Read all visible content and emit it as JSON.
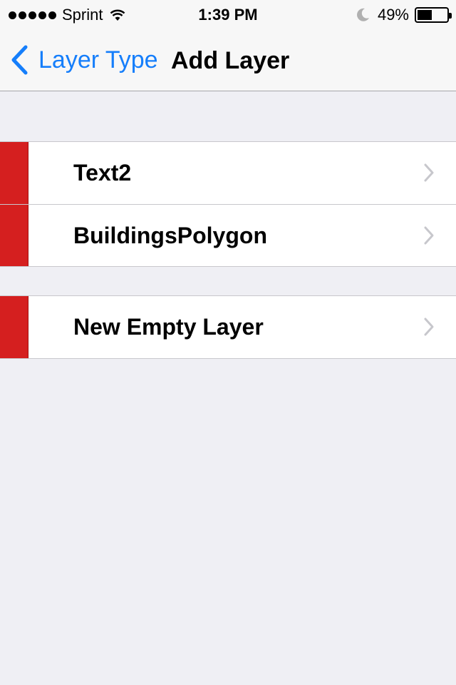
{
  "status_bar": {
    "carrier": "Sprint",
    "time": "1:39 PM",
    "battery_percent": "49%",
    "battery_level": 0.49,
    "signal_bars": 5
  },
  "nav": {
    "back_label": "Layer Type",
    "title": "Add Layer"
  },
  "sections": [
    {
      "items": [
        {
          "label": "Text2",
          "color": "#d51f1f"
        },
        {
          "label": "BuildingsPolygon",
          "color": "#d51f1f"
        }
      ]
    },
    {
      "items": [
        {
          "label": "New Empty Layer",
          "color": "#d51f1f"
        }
      ]
    }
  ],
  "colors": {
    "accent": "#157efb",
    "background": "#efeff4",
    "layer_color": "#d51f1f"
  },
  "icons": [
    "signal-icon",
    "wifi-icon",
    "moon-icon",
    "battery-icon",
    "back-chevron-icon",
    "disclosure-chevron-icon"
  ]
}
